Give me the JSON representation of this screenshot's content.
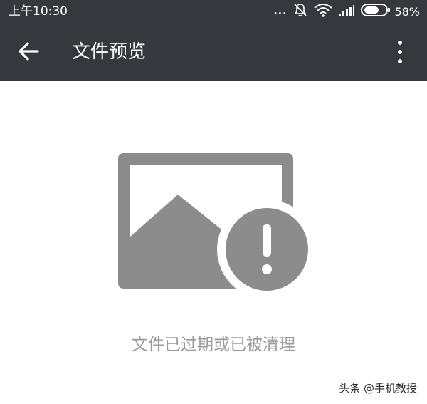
{
  "status_bar": {
    "time": "上午10:30",
    "dots": "...",
    "battery_percent": "58%",
    "icons": [
      "alarm-off-icon",
      "wifi-icon",
      "signal-icon",
      "battery-icon"
    ]
  },
  "app_bar": {
    "title": "文件预览",
    "back_icon": "back-arrow-icon",
    "menu_icon": "more-vertical-icon"
  },
  "content": {
    "icon": "image-expired-icon",
    "message": "文件已过期或已被清理"
  },
  "watermark": "头条 @手机教授",
  "colors": {
    "bar_background": "#36383e",
    "icon_gray": "#8c8c8c",
    "message_text": "#9a9a9a",
    "page_background": "#ffffff"
  }
}
